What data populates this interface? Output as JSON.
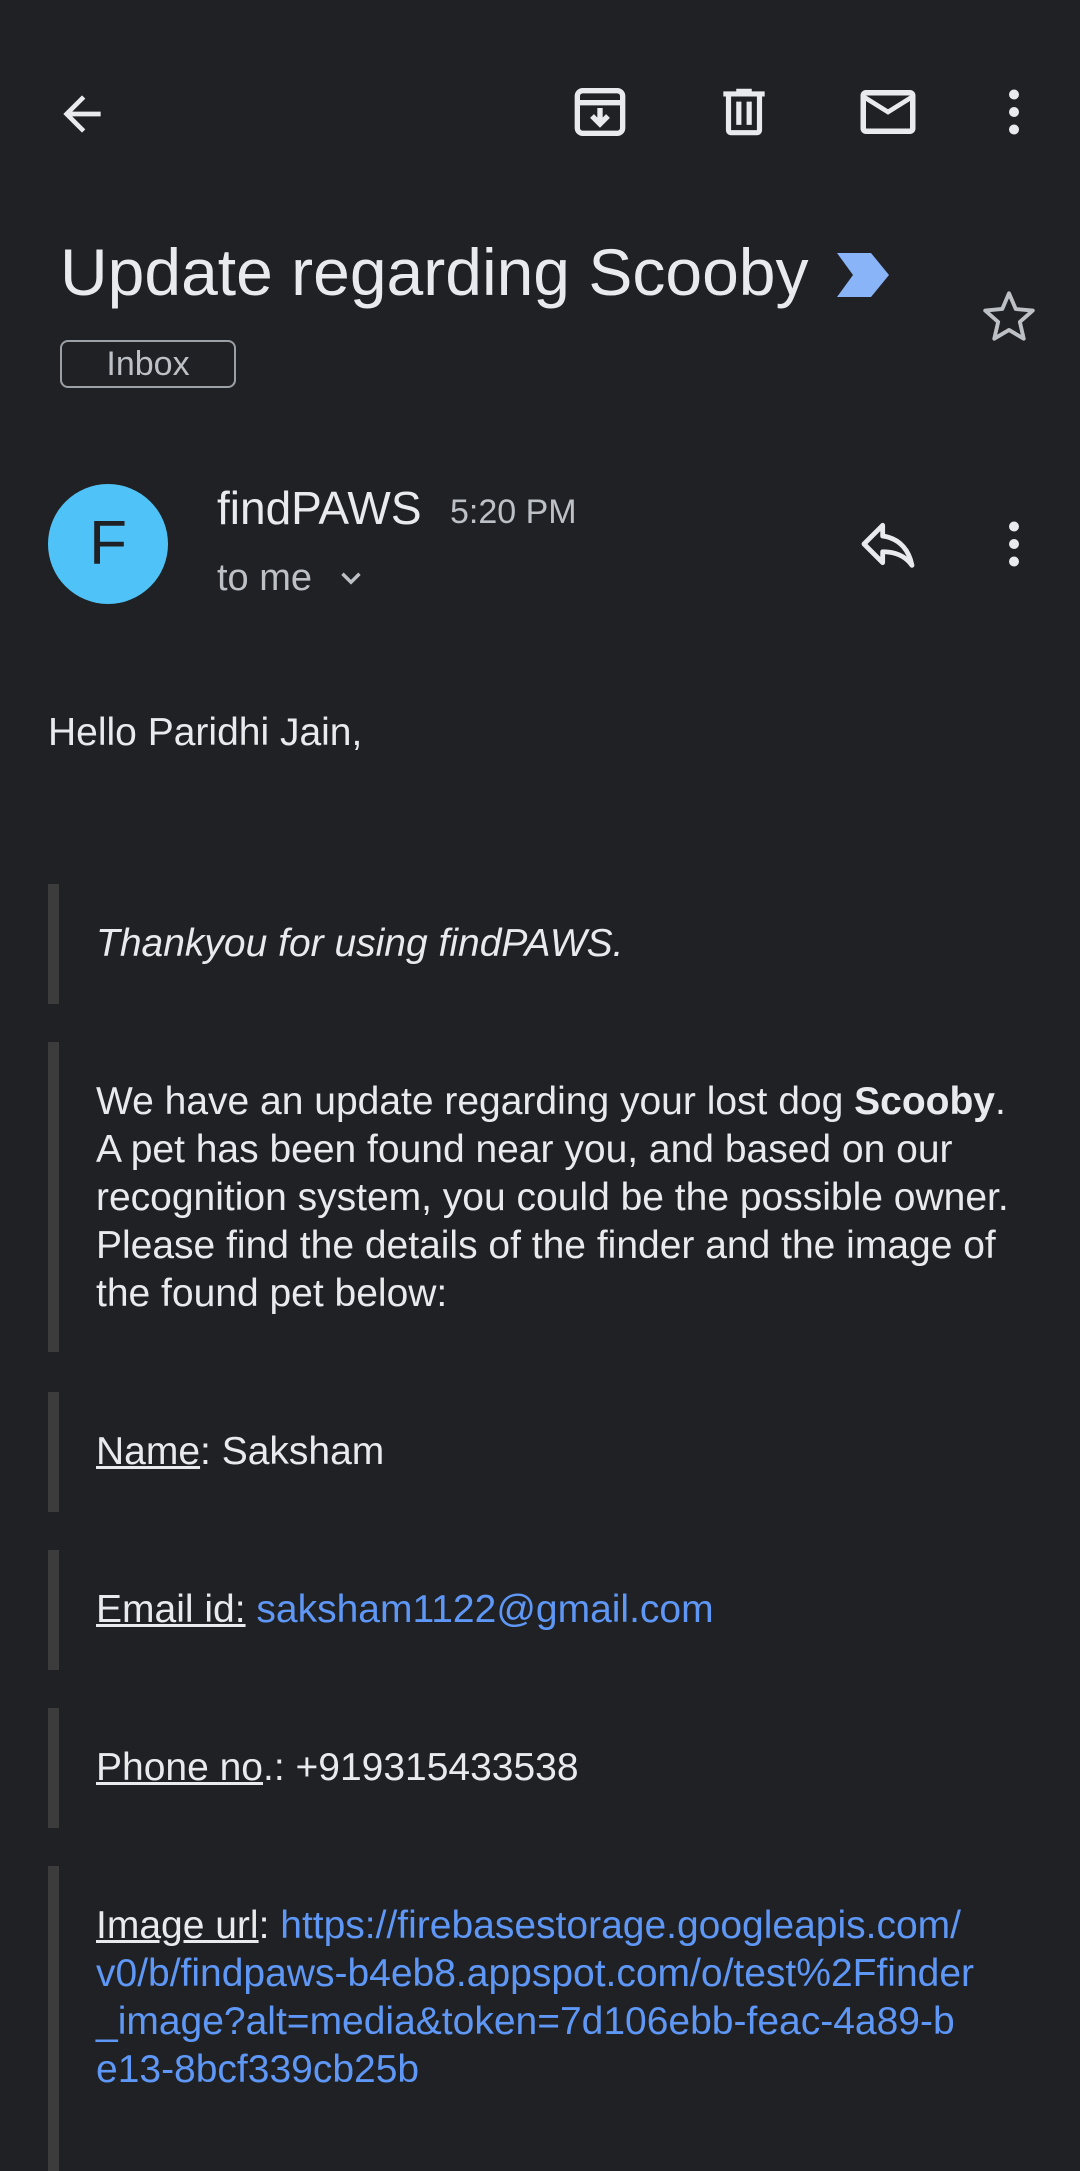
{
  "toolbar": {
    "back_icon": "arrow-back-icon",
    "archive_icon": "archive-icon",
    "delete_icon": "delete-icon",
    "mark_unread_icon": "mail-icon",
    "more_icon": "more-vert-icon"
  },
  "subject": {
    "title": "Update regarding Scooby",
    "important_color": "#8ab4f8",
    "label": "Inbox",
    "star_icon": "star-outline-icon"
  },
  "message": {
    "avatar_letter": "F",
    "avatar_color": "#4fc3f7",
    "sender": "findPAWS",
    "time": "5:20 PM",
    "recipient": "to me",
    "reply_icon": "reply-icon",
    "more_icon": "more-vert-icon"
  },
  "body": {
    "greeting": "Hello Paridhi Jain,",
    "thanks": "Thankyou for using findPAWS.",
    "update_part1": "We have an update regarding your lost dog ",
    "update_bold": "Scooby",
    "update_part2": ". A pet has been found near you, and based on our recognition system, you could be the possible owner. Please find the details of the finder and the image of the found pet below:",
    "name_label": "Name",
    "name_value": ": Saksham",
    "email_label": "Email id:",
    "email_value": "saksham1122@gmail.com",
    "phone_label": "Phone no",
    "phone_value": ".: +919315433538",
    "image_label": "Image url",
    "image_sep": ": ",
    "image_url": "https://firebasestorage.googleapis.com/v0/b/findpaws-b4eb8.appspot.com/o/test%2Ffinder_image?alt=media&token=7d106ebb-feac-4a89-be13-8bcf339cb25b"
  },
  "colors": {
    "background": "#202124",
    "text": "#e8eaed",
    "link": "#5e97f6"
  }
}
